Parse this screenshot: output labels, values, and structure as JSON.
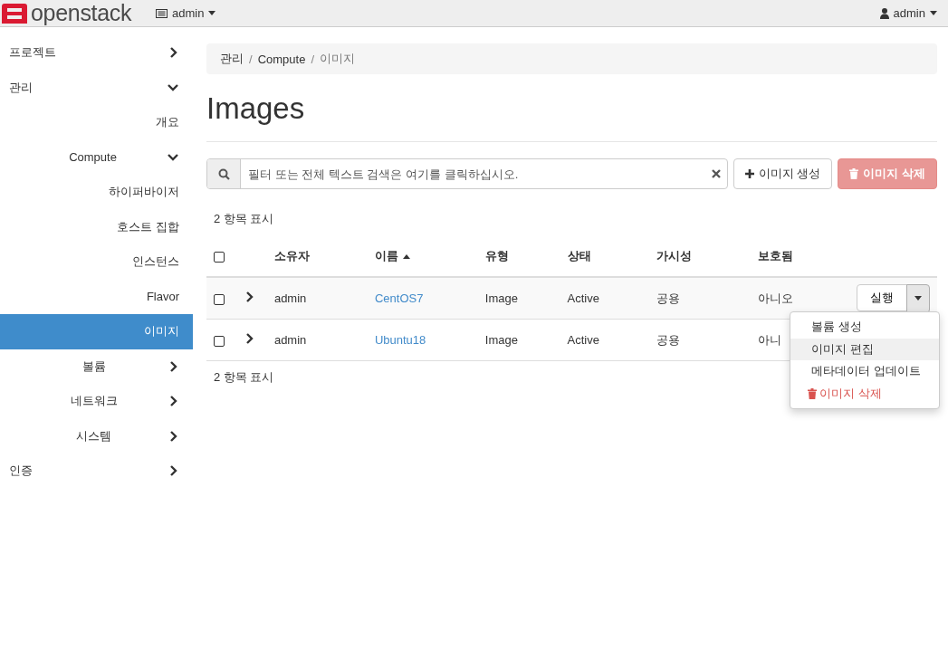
{
  "topbar": {
    "brand": "openstack",
    "project_menu": "admin",
    "user_menu": "admin"
  },
  "sidebar": {
    "items": [
      {
        "label": "프로젝트",
        "expanded": false
      },
      {
        "label": "관리",
        "expanded": true,
        "children": [
          {
            "label": "개요",
            "selected": false
          },
          {
            "label": "Compute",
            "expanded": true,
            "children": [
              {
                "label": "하이퍼바이저",
                "selected": false
              },
              {
                "label": "호스트 집합",
                "selected": false
              },
              {
                "label": "인스턴스",
                "selected": false
              },
              {
                "label": "Flavor",
                "selected": false
              },
              {
                "label": "이미지",
                "selected": true
              }
            ]
          },
          {
            "label": "볼륨",
            "expanded": false
          },
          {
            "label": "네트워크",
            "expanded": false
          },
          {
            "label": "시스템",
            "expanded": false
          }
        ]
      },
      {
        "label": "인증",
        "expanded": false
      }
    ]
  },
  "breadcrumb": [
    {
      "label": "관리",
      "separator": "/"
    },
    {
      "label": "Compute",
      "separator": "/"
    },
    {
      "label": "이미지"
    }
  ],
  "page_title": "Images",
  "search": {
    "placeholder": "필터 또는 전체 텍스트 검색은 여기를 클릭하십시오."
  },
  "buttons": [
    {
      "kind": "create",
      "label": "이미지 생성"
    },
    {
      "kind": "delete",
      "label": "이미지 삭제",
      "disabled": true
    }
  ],
  "count_top": "2 항목 표시",
  "table": {
    "select_all": false,
    "columns": [
      {
        "label": "소유자",
        "sorted": false
      },
      {
        "label": "이름",
        "sorted": true
      },
      {
        "label": "유형",
        "sorted": false
      },
      {
        "label": "상태",
        "sorted": false
      },
      {
        "label": "가시성",
        "sorted": false
      },
      {
        "label": "보호됨",
        "sorted": false
      }
    ],
    "rows": [
      {
        "checked": false,
        "owner": "admin",
        "name": "CentOS7",
        "type": "Image",
        "status": "Active",
        "visibility": "공용",
        "protected": "아니오",
        "action": "실행",
        "menu_open": true
      },
      {
        "checked": false,
        "owner": "admin",
        "name": "Ubuntu18",
        "type": "Image",
        "status": "Active",
        "visibility": "공용",
        "protected": "아니"
      }
    ]
  },
  "row_menu": [
    {
      "label": "볼륨 생성",
      "kind": "normal",
      "selected": false
    },
    {
      "label": "이미지 편집",
      "kind": "normal",
      "selected": true
    },
    {
      "label": "메타데이터 업데이트",
      "kind": "normal",
      "selected": false
    },
    {
      "label": "이미지 삭제",
      "kind": "danger",
      "selected": false
    }
  ],
  "count_bottom": "2 항목 표시"
}
